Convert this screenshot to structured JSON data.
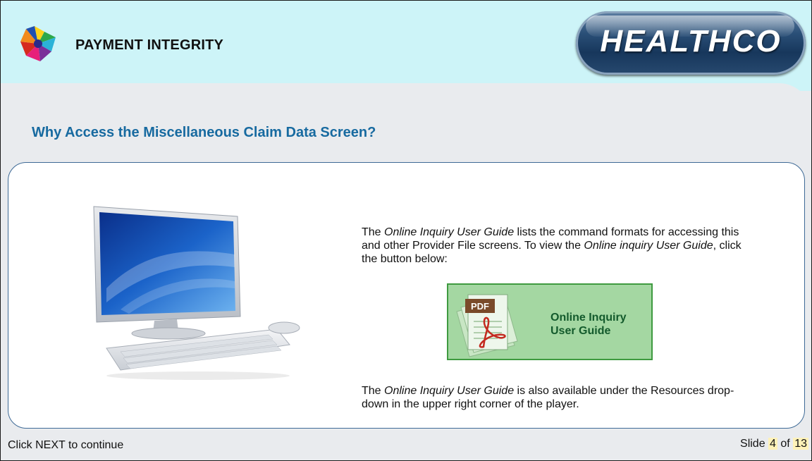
{
  "header": {
    "brand_title": "PAYMENT INTEGRITY",
    "company_logo_text": "HEALTHCO"
  },
  "slide": {
    "heading": "Why Access the Miscellaneous Claim Data Screen?",
    "paragraph1": {
      "pre": "The ",
      "italic1": "Online Inquiry User Guide",
      "mid": " lists the command formats for accessing this and other Provider File screens. To view the ",
      "italic2": "Online inquiry User Guide",
      "post": ", click the button below:"
    },
    "guide_button": {
      "pdf_badge": "PDF",
      "line1": "Online Inquiry",
      "line2": "User Guide"
    },
    "paragraph2": {
      "pre": "The ",
      "italic": "Online Inquiry User Guide",
      "post": " is also available under the Resources drop-down in the upper right corner of the player."
    }
  },
  "footer": {
    "instruction": "Click NEXT to continue",
    "slide_prefix": "Slide",
    "current": "4",
    "of_text": "of",
    "total": "13"
  },
  "icons": {
    "logo": "pinwheel-logo-icon",
    "computer": "desktop-computer-illustration",
    "pdf": "pdf-document-icon"
  },
  "colors": {
    "header_bg": "#cdf4f8",
    "heading": "#176aa0",
    "button_bg": "#a4d7a2",
    "button_border": "#3f9a40",
    "button_text": "#135a2c"
  }
}
